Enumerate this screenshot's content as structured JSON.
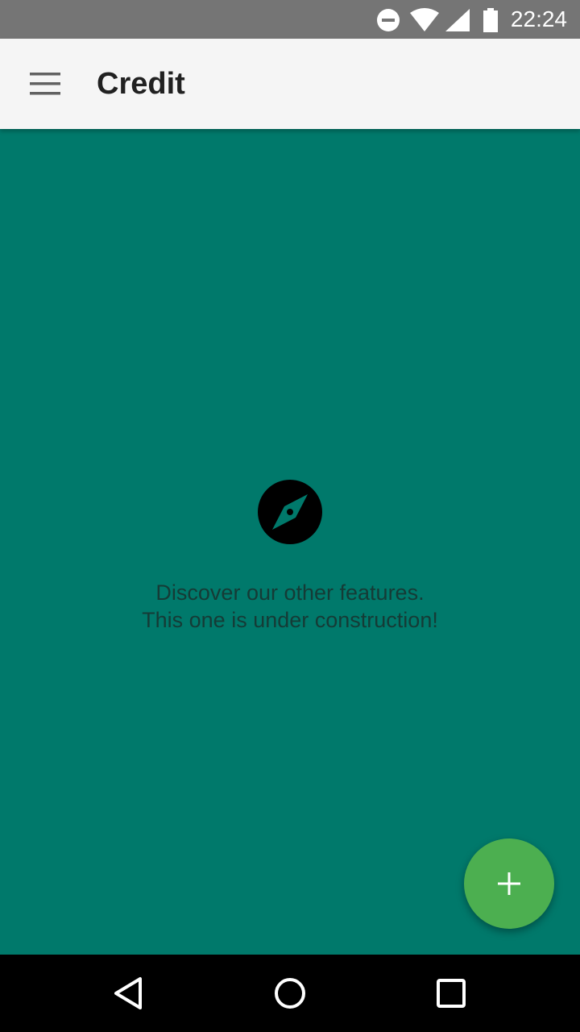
{
  "status_bar": {
    "time": "22:24",
    "icons": [
      "do-not-disturb-icon",
      "wifi-icon",
      "signal-icon",
      "battery-icon"
    ]
  },
  "app_bar": {
    "menu_icon": "hamburger-menu-icon",
    "title": "Credit"
  },
  "empty_state": {
    "icon": "compass-icon",
    "message": "Discover our other features.\nThis one is under construction!"
  },
  "fab": {
    "icon": "plus-icon"
  },
  "nav_bar": {
    "icons": [
      "back-icon",
      "home-icon",
      "recents-icon"
    ]
  },
  "colors": {
    "background": "#00796B",
    "app_bar": "#F5F5F5",
    "status_bar": "#757575",
    "fab": "#4CAF50",
    "nav_bar": "#000000"
  }
}
